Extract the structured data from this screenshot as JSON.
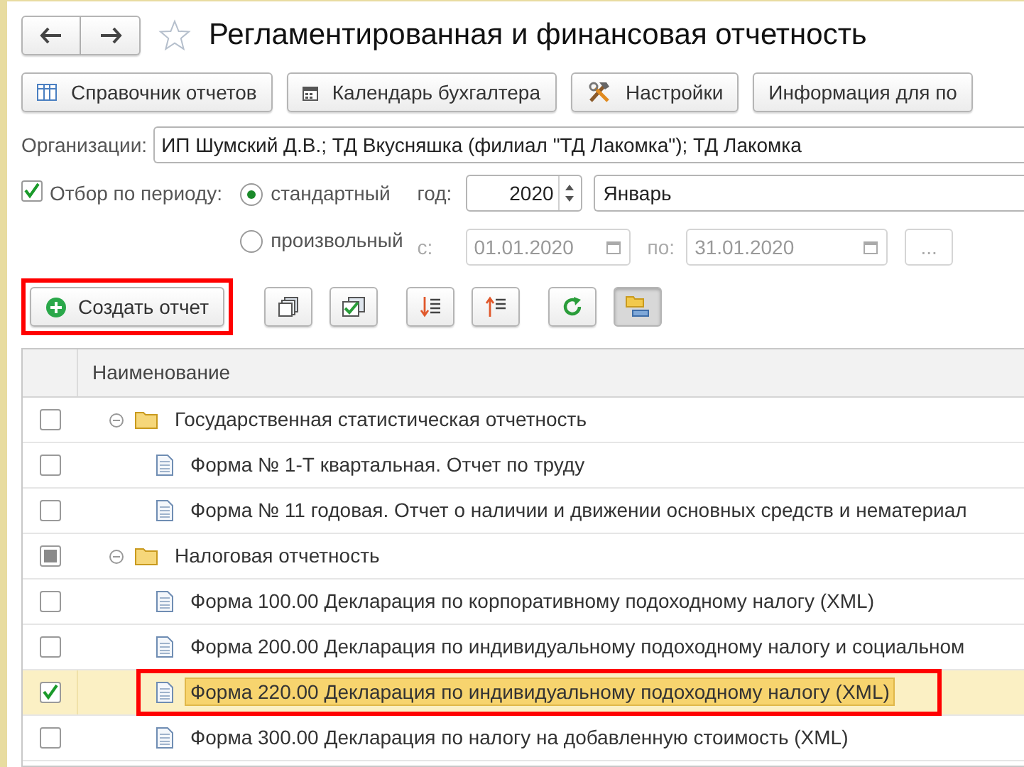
{
  "window": {
    "title": "Регламентированная и финансовая отчетность"
  },
  "top_buttons": [
    {
      "kind": "table",
      "label": "Справочник отчетов"
    },
    {
      "kind": "calendar",
      "label": "Календарь бухгалтера"
    },
    {
      "kind": "tools",
      "label": "Настройки"
    },
    {
      "kind": "none",
      "label": "Информация для по"
    }
  ],
  "organizations": {
    "label": "Организации:",
    "value": "ИП Шумский Д.В.; ТД Вкусняшка (филиал \"ТД Лакомка\"); ТД Лакомка"
  },
  "period_filter": {
    "label": "Отбор по периоду:",
    "checked": true,
    "options": [
      {
        "label": "стандартный",
        "selected": true
      },
      {
        "label": "произвольный",
        "selected": false
      }
    ],
    "year_label": "год:",
    "year": "2020",
    "month": "Январь",
    "from_label": "с:",
    "from": "01.01.2020",
    "to_label": "по:",
    "to": "31.01.2020",
    "dates_disabled": true,
    "more": "..."
  },
  "create_button": {
    "label": "Создать отчет",
    "highlighted": true
  },
  "toolbar": [
    {
      "kind": "copy",
      "pressed": false
    },
    {
      "kind": "check-all",
      "pressed": false
    },
    {
      "kind": "sort-down",
      "pressed": false
    },
    {
      "kind": "sort-up",
      "pressed": false
    },
    {
      "kind": "refresh",
      "pressed": false
    },
    {
      "kind": "hierarchy",
      "pressed": true
    }
  ],
  "table": {
    "columns": [
      "Наименование"
    ],
    "rows": [
      {
        "label": "Государственная статистическая отчетность",
        "checked": false,
        "partial": false,
        "selected": false,
        "highlighted": false,
        "expanded": true,
        "children": [
          {
            "label": "Форма № 1-Т квартальная. Отчет по труду",
            "checked": false,
            "selected": false,
            "highlighted": false
          },
          {
            "label": "Форма № 11 годовая. Отчет о наличии и движении основных средств и нематериал",
            "checked": false,
            "selected": false,
            "highlighted": false
          }
        ]
      },
      {
        "label": "Налоговая отчетность",
        "checked": false,
        "partial": true,
        "selected": false,
        "highlighted": false,
        "expanded": true,
        "children": [
          {
            "label": "Форма 100.00 Декларация по корпоративному подоходному налогу (XML)",
            "checked": false,
            "selected": false,
            "highlighted": false
          },
          {
            "label": "Форма 200.00 Декларация по индивидуальному подоходному налогу и социальном",
            "checked": false,
            "selected": false,
            "highlighted": false
          },
          {
            "label": "Форма 220.00 Декларация по индивидуальному подоходному налогу (XML)",
            "checked": true,
            "selected": true,
            "highlighted": true
          },
          {
            "label": "Форма 300.00 Декларация по налогу на добавленную стоимость (XML)",
            "checked": false,
            "selected": false,
            "highlighted": false
          }
        ]
      }
    ]
  }
}
